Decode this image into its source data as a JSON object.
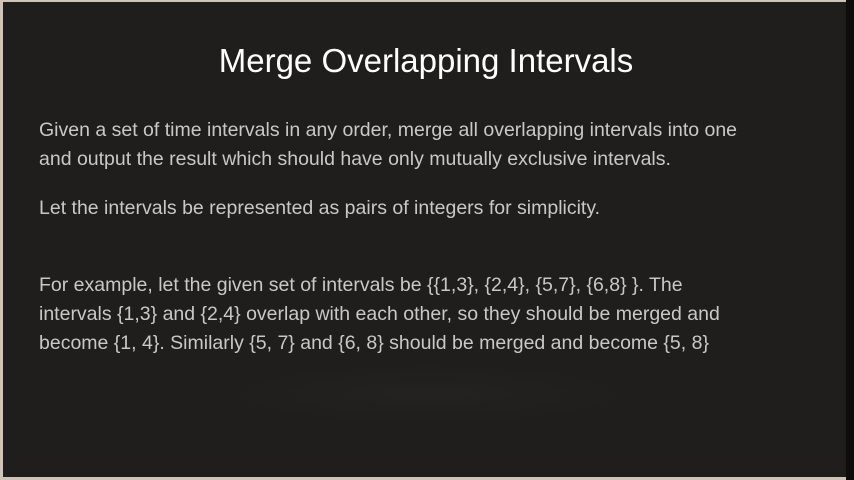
{
  "slide": {
    "title": "Merge Overlapping Intervals",
    "paragraphs": [
      {
        "lines": [
          "Given a set of time intervals in any order, merge all overlapping intervals into one",
          "and output the result which should have only mutually exclusive intervals."
        ]
      },
      {
        "lines": [
          "Let the intervals be represented as pairs of integers for simplicity."
        ]
      },
      {
        "lines": [
          "For example, let the given set of intervals be {{1,3}, {2,4}, {5,7}, {6,8} }. The",
          "intervals {1,3} and {2,4} overlap with each other, so they should be merged and",
          "become {1, 4}. Similarly {5, 7} and {6, 8} should be merged and become {5, 8}"
        ]
      }
    ]
  },
  "colors": {
    "background": "#1f1e1d",
    "title": "#ffffff",
    "body_text": "#c8c8c8",
    "frame_border": "#cfc4b5"
  }
}
